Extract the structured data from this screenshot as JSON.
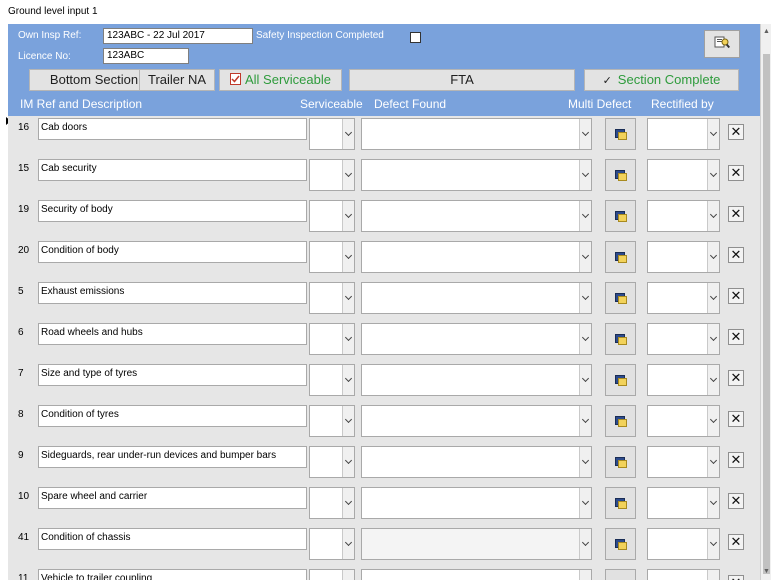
{
  "window": {
    "title": "Ground level input 1"
  },
  "header": {
    "own_insp_ref_label": "Own Insp Ref:",
    "own_insp_ref_value": "123ABC - 22 Jul 2017",
    "safety_label": "Safety Inspection Completed",
    "licence_label": "Licence No:",
    "licence_value": "123ABC"
  },
  "toolbar": {
    "bottom_section": "Bottom Section",
    "trailer_na": "Trailer NA",
    "all_serviceable": "All Serviceable",
    "fta": "FTA",
    "section_complete": "Section Complete"
  },
  "columns": {
    "im_ref": "IM Ref  and Description",
    "serviceable": "Serviceable",
    "defect_found": "Defect Found",
    "multi_defect": "Multi Defect",
    "rectified_by": "Rectified by"
  },
  "rows": [
    {
      "num": "16",
      "desc": "Cab doors"
    },
    {
      "num": "15",
      "desc": "Cab security"
    },
    {
      "num": "19",
      "desc": "Security of body"
    },
    {
      "num": "20",
      "desc": "Condition of body"
    },
    {
      "num": "5",
      "desc": "Exhaust emissions"
    },
    {
      "num": "6",
      "desc": "Road wheels and hubs"
    },
    {
      "num": "7",
      "desc": "Size and type of tyres"
    },
    {
      "num": "8",
      "desc": "Condition of tyres"
    },
    {
      "num": "9",
      "desc": "Sideguards, rear under-run devices and bumper bars"
    },
    {
      "num": "10",
      "desc": "Spare wheel and carrier"
    },
    {
      "num": "41",
      "desc": "Condition of chassis"
    },
    {
      "num": "11",
      "desc": "Vehicle to trailer coupling"
    }
  ],
  "icons": {
    "corner": "document-search-icon",
    "multi_defect": "multi-defect-icon",
    "delete": "close-icon",
    "all_serviceable": "checklist-icon",
    "section_complete": "checkmark-icon"
  },
  "colors": {
    "header_bg": "#7aa2dc",
    "green_text": "#2e9b3c",
    "row_bg": "#e6e6e6"
  }
}
